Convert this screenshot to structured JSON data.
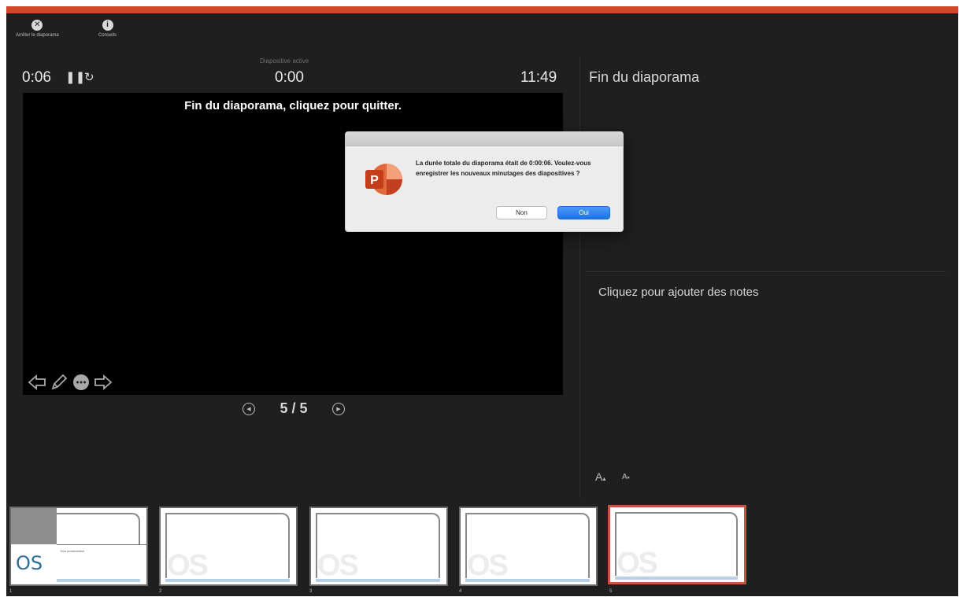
{
  "toolbar": {
    "end_show_label": "Arrêter le diaporama",
    "tips_label": "Conseils"
  },
  "timers": {
    "elapsed": "0:06",
    "active_slide_label": "Diapositive active",
    "slide_time": "0:00",
    "clock": "11:49"
  },
  "slide": {
    "end_text": "Fin du diaporama, cliquez pour quitter."
  },
  "nav": {
    "counter": "5 / 5"
  },
  "next_slide": {
    "title": "Fin du diaporama"
  },
  "notes": {
    "placeholder": "Cliquez pour ajouter des notes"
  },
  "font_controls": {
    "increase": "A",
    "decrease": "A"
  },
  "thumbnails": [
    {
      "number": "1",
      "logo": "OS",
      "caption": "Your presentation"
    },
    {
      "number": "2",
      "logo": "OS"
    },
    {
      "number": "3",
      "logo": "OS"
    },
    {
      "number": "4",
      "logo": "OS"
    },
    {
      "number": "5",
      "logo": "OS"
    }
  ],
  "dialog": {
    "app_icon": "powerpoint-icon",
    "app_icon_letter": "P",
    "message": "La durée totale du diaporama était de 0:00:06. Voulez-vous enregistrer les nouveaux minutages des diapositives ?",
    "no_label": "Non",
    "yes_label": "Oui"
  },
  "colors": {
    "accent": "#d24726",
    "background": "#1f1f1f",
    "primary_button": "#1a73e8",
    "active_thumb_border": "#c8553d"
  }
}
